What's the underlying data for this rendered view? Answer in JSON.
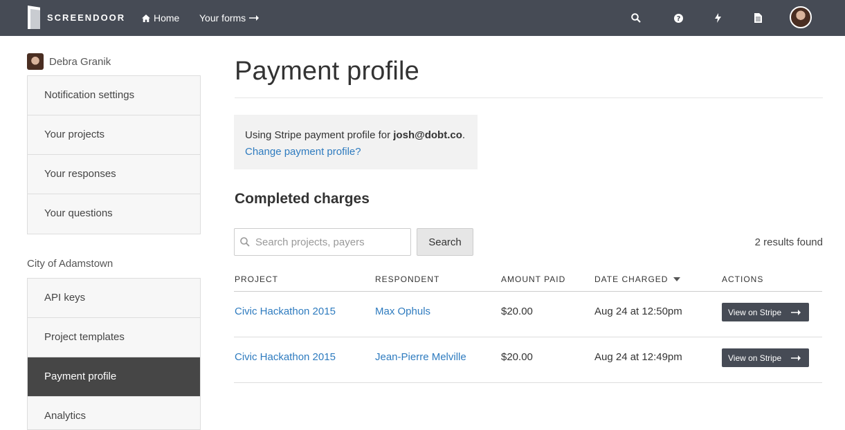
{
  "nav": {
    "brand": "SCREENDOOR",
    "home_label": "Home",
    "forms_label": "Your forms",
    "icons": [
      "search-icon",
      "help-icon",
      "bolt-icon",
      "document-icon"
    ]
  },
  "user": {
    "name": "Debra Granik"
  },
  "sidebar": {
    "personal_items": [
      {
        "label": "Notification settings"
      },
      {
        "label": "Your projects"
      },
      {
        "label": "Your responses"
      },
      {
        "label": "Your questions"
      }
    ],
    "org_label": "City of Adamstown",
    "org_items": [
      {
        "label": "API keys"
      },
      {
        "label": "Project templates"
      },
      {
        "label": "Payment profile",
        "active": true
      },
      {
        "label": "Analytics"
      }
    ]
  },
  "page": {
    "title": "Payment profile",
    "info_prefix": "Using Stripe payment profile for ",
    "info_email": "josh@dobt.co",
    "info_suffix": ".",
    "change_link": "Change payment profile?",
    "section_title": "Completed charges"
  },
  "search": {
    "placeholder": "Search projects, payers",
    "button_label": "Search",
    "results_text": "2 results found"
  },
  "table": {
    "headers": {
      "project": "PROJECT",
      "respondent": "RESPONDENT",
      "amount": "AMOUNT PAID",
      "date": "DATE CHARGED",
      "actions": "ACTIONS"
    },
    "rows": [
      {
        "project": "Civic Hackathon 2015",
        "respondent": "Max Ophuls",
        "amount": "$20.00",
        "date": "Aug 24 at 12:50pm",
        "action": "View on Stripe"
      },
      {
        "project": "Civic Hackathon 2015",
        "respondent": "Jean-Pierre Melville",
        "amount": "$20.00",
        "date": "Aug 24 at 12:49pm",
        "action": "View on Stripe"
      }
    ]
  },
  "colors": {
    "nav_bg": "#464b55",
    "link": "#2e7bbf",
    "active_item_bg": "#464646"
  }
}
